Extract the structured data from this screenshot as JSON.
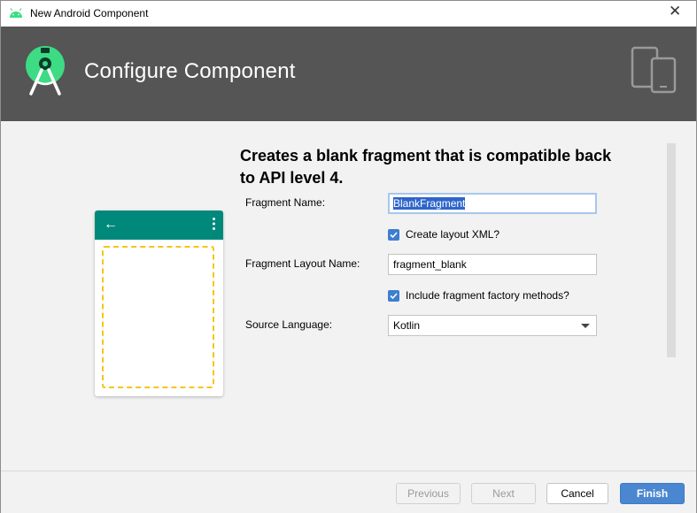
{
  "window": {
    "title": "New Android Component",
    "close_glyph": "✕"
  },
  "banner": {
    "heading": "Configure Component"
  },
  "description": "Creates a blank fragment that is compatible back to API level 4.",
  "preview": {
    "back_glyph": "←"
  },
  "form": {
    "fragment_name": {
      "label": "Fragment Name:",
      "value": "BlankFragment"
    },
    "create_layout_xml": {
      "label": "Create layout XML?",
      "checked": true
    },
    "fragment_layout_name": {
      "label": "Fragment Layout Name:",
      "value": "fragment_blank"
    },
    "include_factory_methods": {
      "label": "Include fragment factory methods?",
      "checked": true
    },
    "source_language": {
      "label": "Source Language:",
      "value": "Kotlin"
    }
  },
  "footer": {
    "previous_label": "Previous",
    "next_label": "Next",
    "cancel_label": "Cancel",
    "finish_label": "Finish"
  },
  "colors": {
    "banner_bg": "#555555",
    "android_green": "#3ddc84",
    "appbar_teal": "#00897b",
    "placeholder_dash": "#f5c518",
    "checkbox_blue": "#3d7ed0",
    "primary_button": "#4a87d0"
  },
  "icons": [
    "android-icon",
    "close-icon",
    "android-studio-logo-icon",
    "devices-icon",
    "arrow-back-icon",
    "more-vert-icon",
    "checkmark-icon",
    "chevron-down-icon"
  ]
}
